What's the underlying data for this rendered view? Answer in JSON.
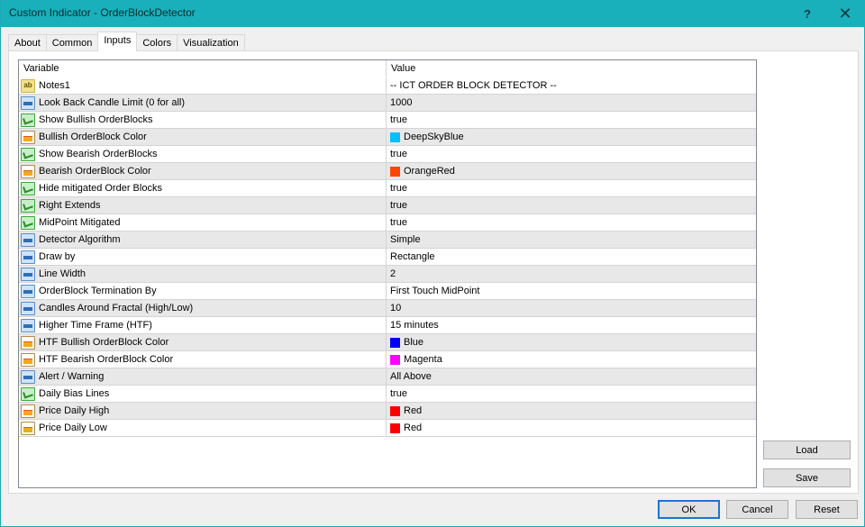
{
  "window": {
    "title": "Custom Indicator - OrderBlockDetector",
    "help_label": "?",
    "close_label": "✕"
  },
  "tabs": [
    {
      "label": "About",
      "active": false
    },
    {
      "label": "Common",
      "active": false
    },
    {
      "label": "Inputs",
      "active": true
    },
    {
      "label": "Colors",
      "active": false
    },
    {
      "label": "Visualization",
      "active": false
    }
  ],
  "grid": {
    "headers": {
      "variable": "Variable",
      "value": "Value"
    },
    "rows": [
      {
        "icon": "string-icon",
        "variable": "Notes1",
        "value": "-- ICT ORDER BLOCK DETECTOR --"
      },
      {
        "icon": "integer-icon",
        "variable": "Look Back Candle Limit (0 for all)",
        "value": "1000"
      },
      {
        "icon": "boolean-icon",
        "variable": "Show Bullish OrderBlocks",
        "value": "true"
      },
      {
        "icon": "color-icon",
        "variable": "Bullish OrderBlock Color",
        "value": "DeepSkyBlue",
        "swatch": "#00bfff"
      },
      {
        "icon": "boolean-icon",
        "variable": "Show Bearish OrderBlocks",
        "value": "true"
      },
      {
        "icon": "color-icon",
        "variable": "Bearish OrderBlock Color",
        "value": "OrangeRed",
        "swatch": "#ff4500"
      },
      {
        "icon": "boolean-icon",
        "variable": "Hide mitigated Order Blocks",
        "value": "true"
      },
      {
        "icon": "boolean-icon",
        "variable": "Right Extends",
        "value": "true"
      },
      {
        "icon": "boolean-icon",
        "variable": "MidPoint Mitigated",
        "value": "true"
      },
      {
        "icon": "integer-icon",
        "variable": "Detector Algorithm",
        "value": "Simple"
      },
      {
        "icon": "integer-icon",
        "variable": "Draw by",
        "value": "Rectangle"
      },
      {
        "icon": "integer-icon",
        "variable": "Line Width",
        "value": "2"
      },
      {
        "icon": "integer-icon",
        "variable": "OrderBlock Termination By",
        "value": "First Touch MidPoint"
      },
      {
        "icon": "integer-icon",
        "variable": "Candles Around Fractal (High/Low)",
        "value": "10"
      },
      {
        "icon": "integer-icon",
        "variable": "Higher Time Frame (HTF)",
        "value": "15 minutes"
      },
      {
        "icon": "color-icon",
        "variable": "HTF Bullish OrderBlock Color",
        "value": "Blue",
        "swatch": "#0000ff"
      },
      {
        "icon": "color-icon",
        "variable": "HTF Bearish OrderBlock Color",
        "value": "Magenta",
        "swatch": "#ff00ff"
      },
      {
        "icon": "integer-icon",
        "variable": "Alert / Warning",
        "value": "All Above"
      },
      {
        "icon": "boolean-icon",
        "variable": "Daily Bias Lines",
        "value": "true"
      },
      {
        "icon": "color-icon",
        "variable": "Price Daily High",
        "value": "Red",
        "swatch": "#ff0000"
      },
      {
        "icon": "color-icon",
        "variable": "Price Daily Low",
        "value": "Red",
        "swatch": "#ff0000"
      }
    ]
  },
  "buttons": {
    "load": "Load",
    "save": "Save",
    "ok": "OK",
    "cancel": "Cancel",
    "reset": "Reset"
  },
  "colors": {
    "titlebar": "#1ab0bb",
    "ok_border": "#1b74d3"
  }
}
